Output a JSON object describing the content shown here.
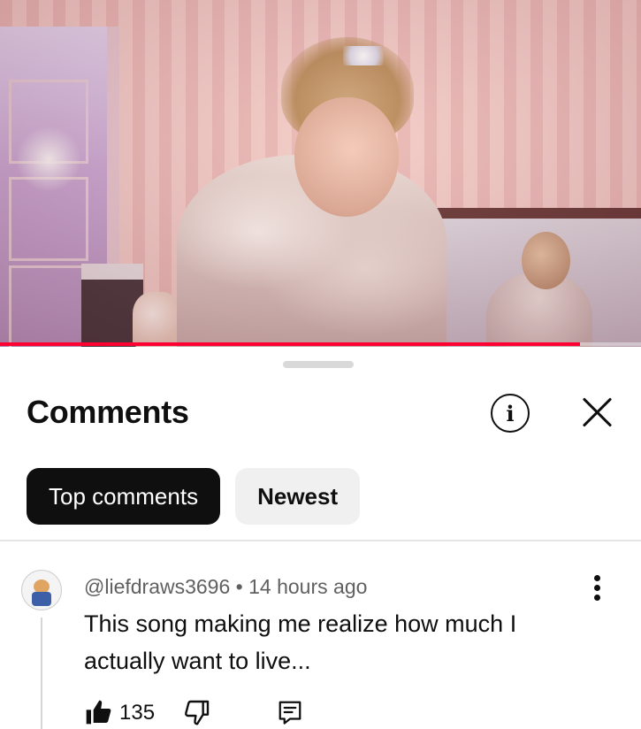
{
  "video": {
    "progress_fraction": 0.905,
    "accent_color": "#ff0033"
  },
  "comments_panel": {
    "title": "Comments",
    "info_icon": "info-icon",
    "close_icon": "close-icon",
    "chips": [
      {
        "label": "Top comments",
        "selected": true
      },
      {
        "label": "Newest",
        "selected": false
      }
    ]
  },
  "comments": [
    {
      "author": "@liefdraws3696",
      "separator": "•",
      "time": "14 hours ago",
      "text": "This song making me realize how much I actually want to live...",
      "likes": "135",
      "like_icon": "thumbs-up-filled-icon",
      "dislike_icon": "thumbs-down-icon",
      "reply_icon": "reply-icon",
      "menu_icon": "more-vertical-icon"
    }
  ]
}
